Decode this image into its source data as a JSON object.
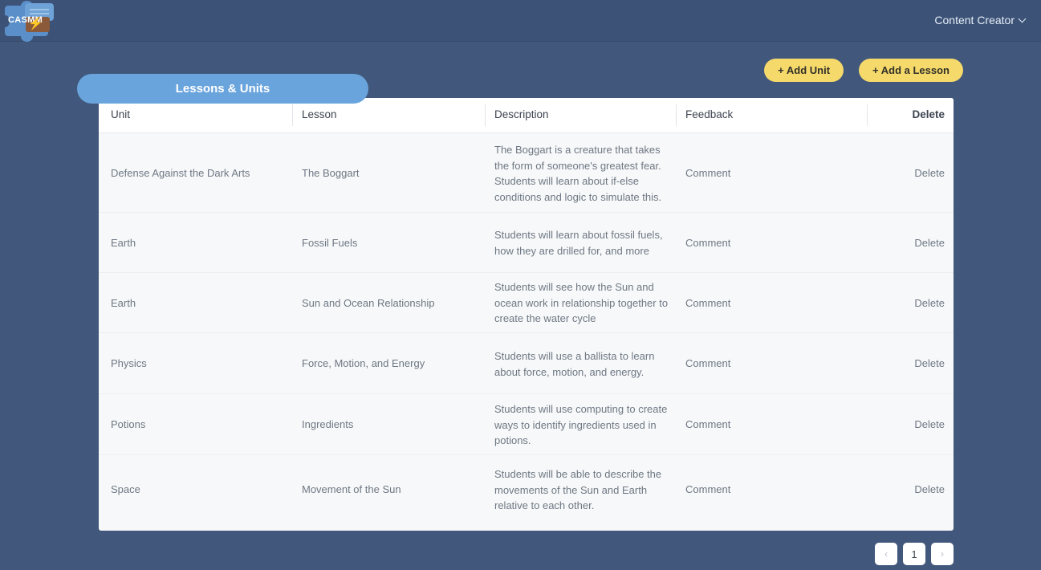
{
  "navbar": {
    "brand_text": "CASMM",
    "brand_icon": "puzzle-piece-logo",
    "bolt_icon": "lightning-bolt-icon",
    "user_menu_label": "Content Creator",
    "chevron_icon": "chevron-down-icon"
  },
  "toolbar": {
    "add_unit_label": "+ Add Unit",
    "add_lesson_label": "+ Add a Lesson"
  },
  "tab": {
    "label": "Lessons & Units"
  },
  "table": {
    "columns": [
      "Unit",
      "Lesson",
      "Description",
      "Feedback",
      "Delete"
    ],
    "rows": [
      {
        "unit": "Defense Against the Dark Arts",
        "lesson": "The Boggart",
        "description": "The Boggart is a creature that takes the form of someone's greatest fear. Students will learn about if-else conditions and logic to simulate this.",
        "feedback": "Comment",
        "delete": "Delete"
      },
      {
        "unit": "Earth",
        "lesson": "Fossil Fuels",
        "description": "Students will learn about fossil fuels, how they are drilled for, and more",
        "feedback": "Comment",
        "delete": "Delete"
      },
      {
        "unit": "Earth",
        "lesson": "Sun and Ocean Relationship",
        "description": "Students will see how the Sun and ocean work in relationship together to create the water cycle",
        "feedback": "Comment",
        "delete": "Delete"
      },
      {
        "unit": "Physics",
        "lesson": "Force, Motion, and Energy",
        "description": "Students will use a ballista to learn about force, motion, and energy.",
        "feedback": "Comment",
        "delete": "Delete"
      },
      {
        "unit": "Potions",
        "lesson": "Ingredients",
        "description": "Students will use computing to create ways to identify ingredients used in potions.",
        "feedback": "Comment",
        "delete": "Delete"
      },
      {
        "unit": "Space",
        "lesson": "Movement of the Sun",
        "description": "Students will be able to describe the movements of the Sun and Earth relative to each other.",
        "feedback": "Comment",
        "delete": "Delete"
      }
    ]
  },
  "pagination": {
    "prev_icon": "chevron-left-icon",
    "next_icon": "chevron-right-icon",
    "current_page": "1"
  },
  "colors": {
    "page_background": "#41587c",
    "navbar_background": "#3c5377",
    "accent_yellow": "#f5d96a",
    "tab_blue": "#6aa4dd",
    "card_background": "#f7f8f9"
  }
}
